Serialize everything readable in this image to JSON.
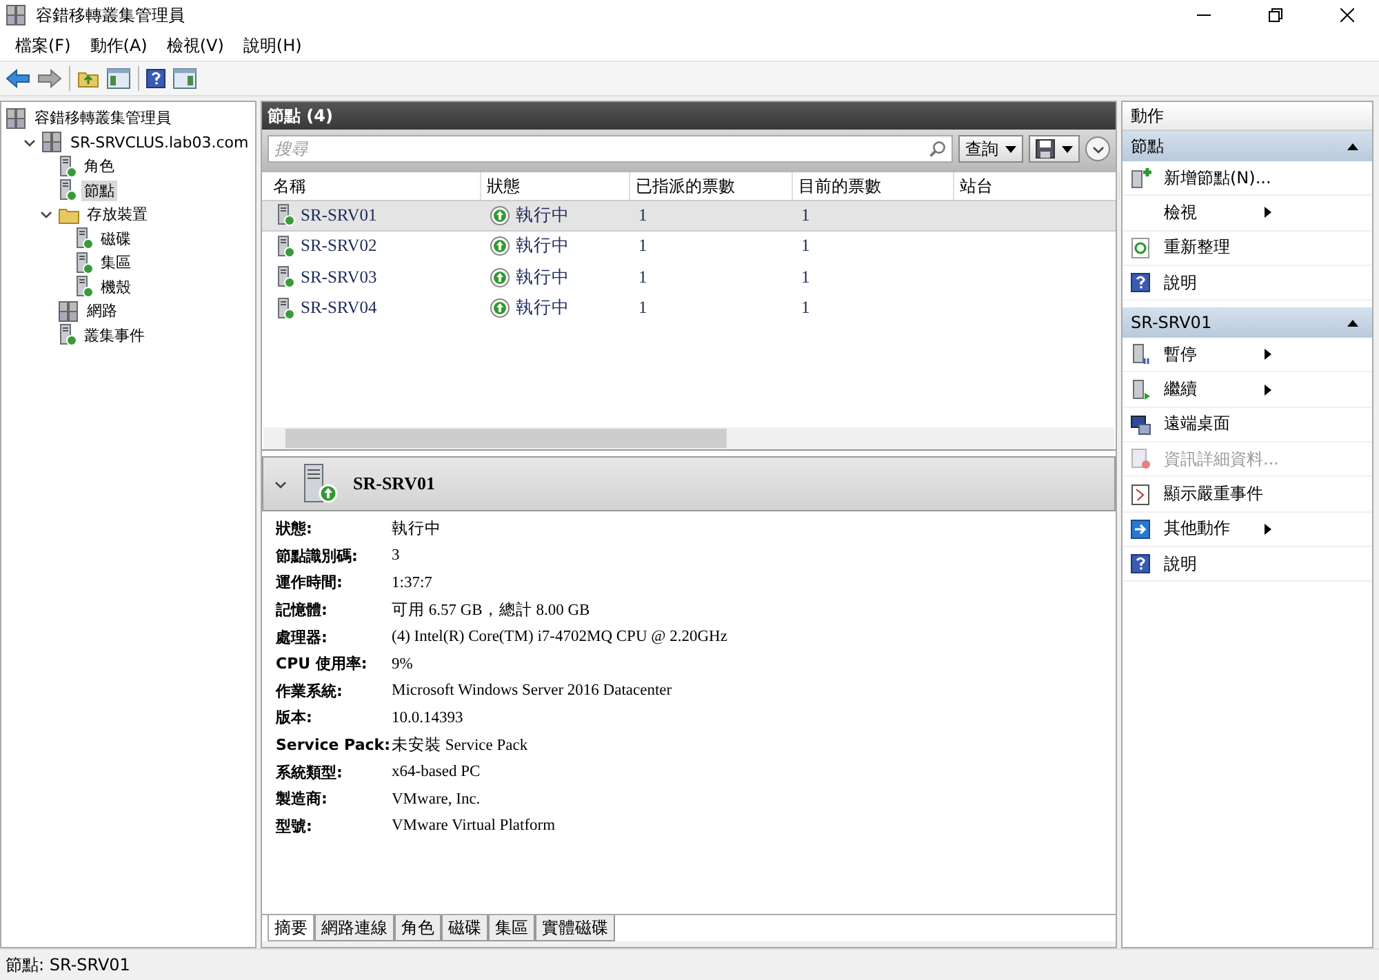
{
  "window": {
    "title": "容錯移轉叢集管理員"
  },
  "menu": [
    "檔案(F)",
    "動作(A)",
    "檢視(V)",
    "說明(H)"
  ],
  "tree": [
    {
      "label": "容錯移轉叢集管理員",
      "selected": false,
      "children": [
        {
          "label": "SR-SRVCLUS.lab03.com",
          "selected": false,
          "expanded": true,
          "children": [
            {
              "label": "角色",
              "selected": false
            },
            {
              "label": "節點",
              "selected": true
            },
            {
              "label": "存放裝置",
              "selected": false,
              "expanded": true,
              "children": [
                {
                  "label": "磁碟",
                  "selected": false
                },
                {
                  "label": "集區",
                  "selected": false
                },
                {
                  "label": "機殼",
                  "selected": false
                }
              ]
            },
            {
              "label": "網路",
              "selected": false
            },
            {
              "label": "叢集事件",
              "selected": false
            }
          ]
        }
      ]
    }
  ],
  "nodes": {
    "title": "節點 (4)",
    "search": {
      "placeholder": "搜尋"
    },
    "query_button": "查詢",
    "columns": [
      "名稱",
      "狀態",
      "已指派的票數",
      "目前的票數",
      "站台"
    ],
    "rows": [
      {
        "name": "SR-SRV01",
        "status": "執行中",
        "assigned_votes": "1",
        "current_votes": "1",
        "selected": true
      },
      {
        "name": "SR-SRV02",
        "status": "執行中",
        "assigned_votes": "1",
        "current_votes": "1",
        "selected": false
      },
      {
        "name": "SR-SRV03",
        "status": "執行中",
        "assigned_votes": "1",
        "current_votes": "1",
        "selected": false
      },
      {
        "name": "SR-SRV04",
        "status": "執行中",
        "assigned_votes": "1",
        "current_votes": "1",
        "selected": false
      }
    ]
  },
  "details": {
    "title": "SR-SRV01",
    "expanded": true,
    "fields": [
      {
        "label": "狀態:",
        "value": "執行中"
      },
      {
        "label": "節點識別碼:",
        "value": "3"
      },
      {
        "label": "運作時間:",
        "value": "1:37:7"
      },
      {
        "label": "記憶體:",
        "value": "可用 6.57 GB，總計 8.00 GB"
      },
      {
        "label": "處理器:",
        "value": "(4) Intel(R) Core(TM) i7-4702MQ CPU @ 2.20GHz"
      },
      {
        "label": "CPU 使用率:",
        "value": "9%"
      },
      {
        "label": "作業系統:",
        "value": "Microsoft Windows Server 2016 Datacenter"
      },
      {
        "label": "版本:",
        "value": "10.0.14393"
      },
      {
        "label": "Service Pack:",
        "value": "未安裝 Service Pack"
      },
      {
        "label": "系統類型:",
        "value": "x64-based PC"
      },
      {
        "label": "製造商:",
        "value": "VMware, Inc."
      },
      {
        "label": "型號:",
        "value": "VMware Virtual Platform"
      }
    ],
    "tabs": [
      {
        "label": "摘要",
        "selected": true
      },
      {
        "label": "網路連線",
        "selected": false
      },
      {
        "label": "角色",
        "selected": false
      },
      {
        "label": "磁碟",
        "selected": false
      },
      {
        "label": "集區",
        "selected": false
      },
      {
        "label": "實體磁碟",
        "selected": false
      }
    ]
  },
  "actions": {
    "title": "動作",
    "sections": [
      {
        "title": "節點",
        "expanded": true,
        "items": [
          {
            "label": "新增節點(N)...",
            "disabled": false,
            "submenu": false
          },
          {
            "label": "檢視",
            "disabled": false,
            "submenu": true
          },
          {
            "label": "重新整理",
            "disabled": false,
            "submenu": false
          },
          {
            "label": "說明",
            "disabled": false,
            "submenu": false
          }
        ]
      },
      {
        "title": "SR-SRV01",
        "expanded": true,
        "items": [
          {
            "label": "暫停",
            "disabled": false,
            "submenu": true
          },
          {
            "label": "繼續",
            "disabled": false,
            "submenu": true
          },
          {
            "label": "遠端桌面",
            "disabled": false,
            "submenu": false
          },
          {
            "label": "資訊詳細資料...",
            "disabled": true,
            "submenu": false
          },
          {
            "label": "顯示嚴重事件",
            "disabled": false,
            "submenu": false
          },
          {
            "label": "其他動作",
            "disabled": false,
            "submenu": true
          },
          {
            "label": "說明",
            "disabled": false,
            "submenu": false
          }
        ]
      }
    ]
  },
  "status_bar": "節點: SR-SRV01"
}
